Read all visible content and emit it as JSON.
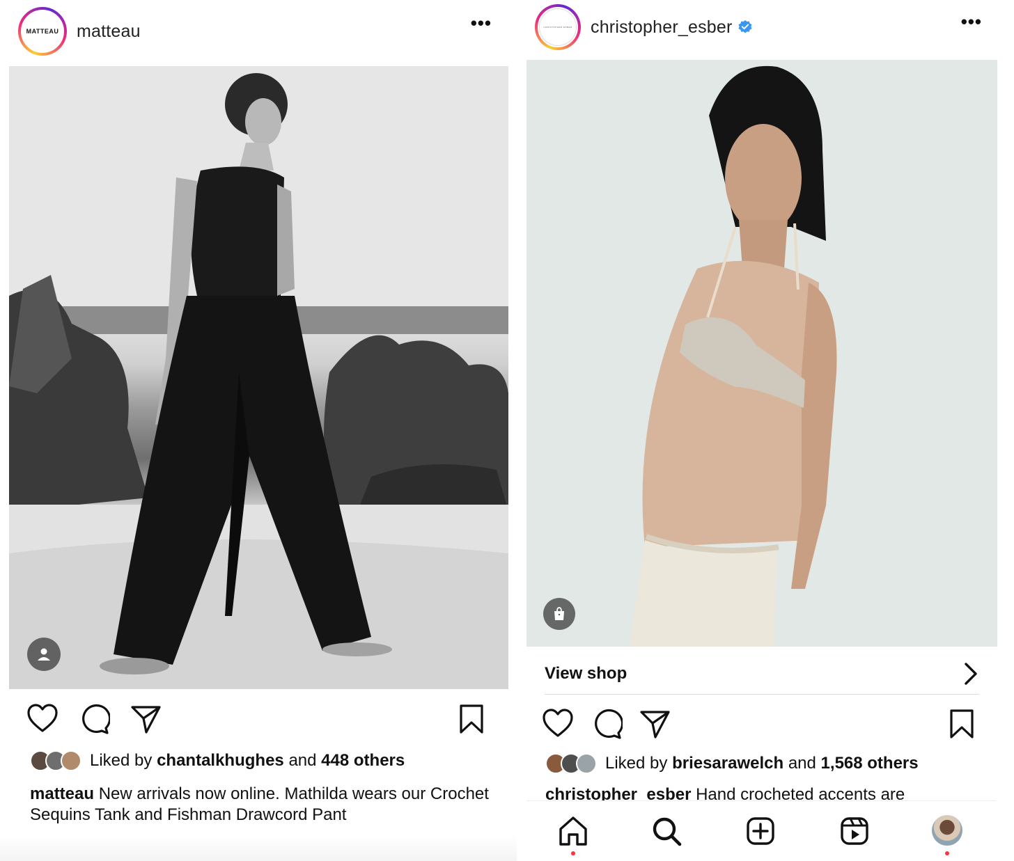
{
  "left_post": {
    "avatar_text": "MATTEAU",
    "username": "matteau",
    "more_label": "•••",
    "likes": {
      "prefix": "Liked by ",
      "user": "chantalkhughes",
      "middle": " and ",
      "others": "448 others"
    },
    "caption": {
      "user": "matteau",
      "text": " New arrivals now online. Mathilda wears our Crochet Sequins Tank and Fishman Drawcord Pant"
    }
  },
  "right_post": {
    "avatar_text": "CHRISTOPHER ESBER",
    "username": "christopher_esber",
    "more_label": "•••",
    "view_shop_label": "View shop",
    "likes": {
      "prefix": "Liked by ",
      "user": "briesarawelch",
      "middle": " and ",
      "others": "1,568 others"
    },
    "caption": {
      "user": "christopher_esber",
      "text": " Hand crocheted accents are"
    }
  },
  "colors": {
    "notification_dot": "#ff3040",
    "verified_badge": "#3897f0",
    "divider": "#dbdbdb"
  },
  "icons": {
    "tabs": [
      "home-icon",
      "search-icon",
      "create-icon",
      "reels-icon",
      "profile-avatar"
    ],
    "actions": [
      "heart-icon",
      "comment-icon",
      "share-icon",
      "bookmark-icon"
    ]
  }
}
